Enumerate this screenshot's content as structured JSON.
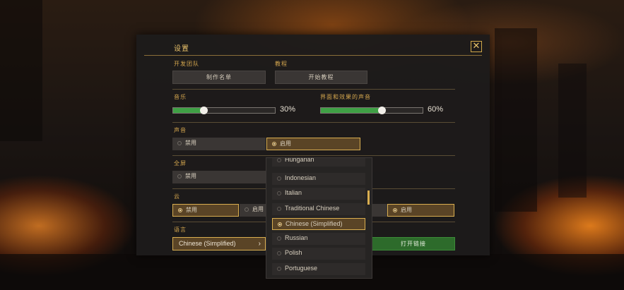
{
  "colors": {
    "accent_gold": "#d9ae50",
    "slider_green": "#3fa045",
    "button_green": "#2d6b2b",
    "panel_bg": "#1d1b1b"
  },
  "settings": {
    "title": "设置",
    "close_icon": "close-icon",
    "dev_team": {
      "label": "开发团队",
      "button": "制作名单"
    },
    "tutorial": {
      "label": "教程",
      "button": "开始教程"
    },
    "music": {
      "label": "音乐",
      "value_text": "30%",
      "level": 0.3
    },
    "ui_sound": {
      "label": "界面和效果的声音",
      "value_text": "60%",
      "level": 0.6
    },
    "sound": {
      "label": "声音",
      "options": [
        "禁用",
        "启用"
      ],
      "selected": "启用"
    },
    "fullscreen": {
      "label": "全屏",
      "options": [
        "禁用"
      ],
      "selected": ""
    },
    "cloud": {
      "label": "云",
      "options": [
        "禁用",
        "启用",
        "启用"
      ],
      "selected": "禁用"
    },
    "language": {
      "label": "语言",
      "value": "Chinese (Simplified)",
      "chevron_icon": "chevron-right-icon"
    },
    "open_link": {
      "label": "打开链接"
    }
  },
  "language_dropdown": {
    "items": [
      "Hungarian",
      "Indonesian",
      "Italian",
      "Traditional Chinese",
      "Chinese (Simplified)",
      "Russian",
      "Polish",
      "Portuguese"
    ],
    "selected": "Chinese (Simplified)"
  }
}
